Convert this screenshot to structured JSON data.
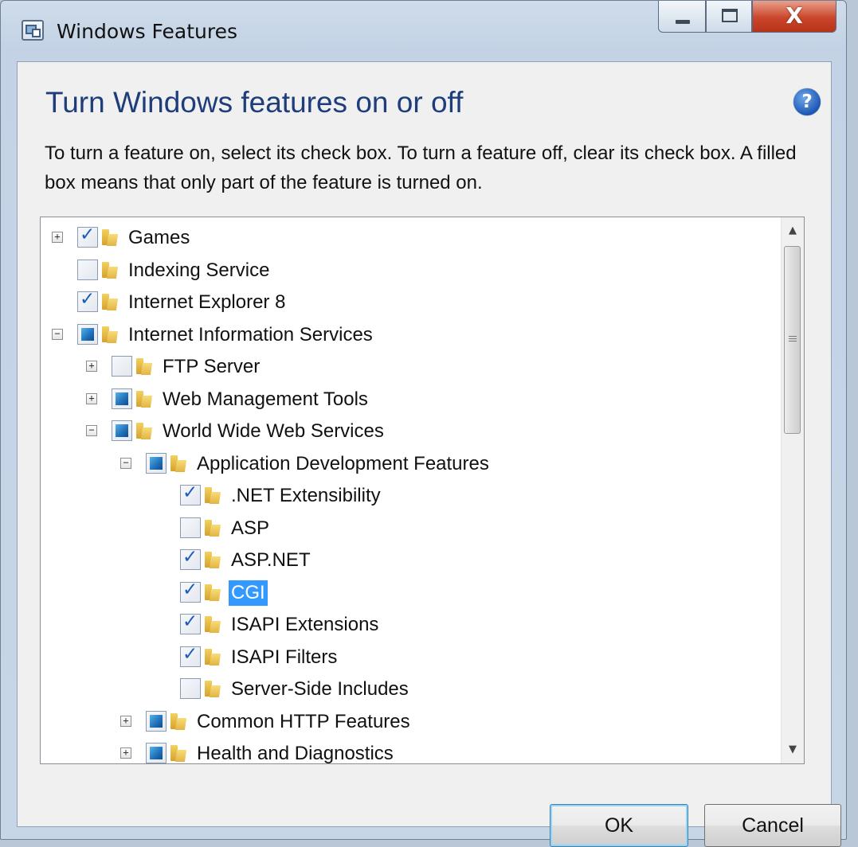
{
  "window": {
    "title": "Windows Features",
    "controls": {
      "minimize": "minimize",
      "maximize": "maximize",
      "close": "X"
    }
  },
  "dialog": {
    "heading": "Turn Windows features on or off",
    "help": "?",
    "description": "To turn a feature on, select its check box. To turn a feature off, clear its check box. A filled box means that only part of the feature is turned on."
  },
  "features": [
    {
      "label": "Games",
      "level": 0,
      "expander": "+",
      "state": "checked"
    },
    {
      "label": "Indexing Service",
      "level": 0,
      "expander": "",
      "state": "unchecked"
    },
    {
      "label": "Internet Explorer 8",
      "level": 0,
      "expander": "",
      "state": "checked"
    },
    {
      "label": "Internet Information Services",
      "level": 0,
      "expander": "−",
      "state": "partial"
    },
    {
      "label": "FTP Server",
      "level": 1,
      "expander": "+",
      "state": "unchecked"
    },
    {
      "label": "Web Management Tools",
      "level": 1,
      "expander": "+",
      "state": "partial"
    },
    {
      "label": "World Wide Web Services",
      "level": 1,
      "expander": "−",
      "state": "partial"
    },
    {
      "label": "Application Development Features",
      "level": 2,
      "expander": "−",
      "state": "partial"
    },
    {
      "label": ".NET Extensibility",
      "level": 3,
      "expander": "",
      "state": "checked"
    },
    {
      "label": "ASP",
      "level": 3,
      "expander": "",
      "state": "unchecked"
    },
    {
      "label": "ASP.NET",
      "level": 3,
      "expander": "",
      "state": "checked"
    },
    {
      "label": "CGI",
      "level": 3,
      "expander": "",
      "state": "checked",
      "selected": true
    },
    {
      "label": "ISAPI Extensions",
      "level": 3,
      "expander": "",
      "state": "checked"
    },
    {
      "label": "ISAPI Filters",
      "level": 3,
      "expander": "",
      "state": "checked"
    },
    {
      "label": "Server-Side Includes",
      "level": 3,
      "expander": "",
      "state": "unchecked"
    },
    {
      "label": "Common HTTP Features",
      "level": 2,
      "expander": "+",
      "state": "partial"
    },
    {
      "label": "Health and Diagnostics",
      "level": 2,
      "expander": "+",
      "state": "partial"
    }
  ],
  "buttons": {
    "ok": "OK",
    "cancel": "Cancel"
  },
  "colors": {
    "heading": "#1e3d7b",
    "selection": "#3399ff",
    "close": "#c9452b",
    "partial_fill": "#1f6fb8"
  }
}
